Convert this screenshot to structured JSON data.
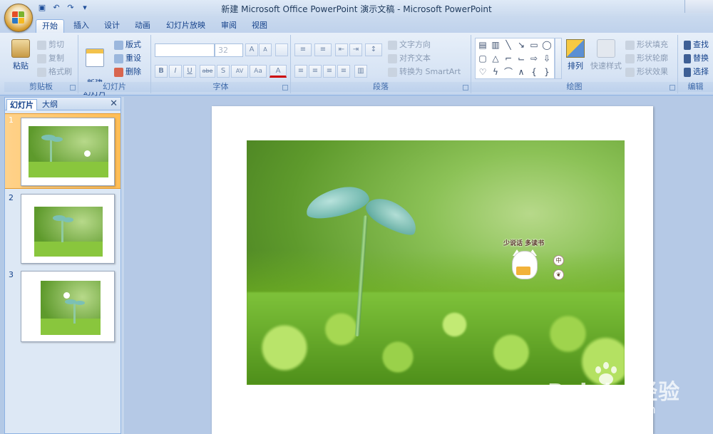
{
  "window": {
    "title": "新建 Microsoft Office PowerPoint 演示文稿 - Microsoft PowerPoint"
  },
  "qat": [
    "save-icon",
    "undo-icon",
    "redo-icon",
    "customize-icon"
  ],
  "tabs": [
    {
      "label": "开始",
      "active": true
    },
    {
      "label": "插入"
    },
    {
      "label": "设计"
    },
    {
      "label": "动画"
    },
    {
      "label": "幻灯片放映"
    },
    {
      "label": "审阅"
    },
    {
      "label": "视图"
    }
  ],
  "clipboard": {
    "group": "剪贴板",
    "paste": "粘贴",
    "cut": "剪切",
    "copy": "复制",
    "format_painter": "格式刷"
  },
  "slides_group": {
    "group": "幻灯片",
    "new_slide": "新建\n幻灯片",
    "layout": "版式",
    "reset": "重设",
    "delete": "删除"
  },
  "font": {
    "group": "字体",
    "name": "",
    "size": "32",
    "bold": "B",
    "italic": "I",
    "underline": "U",
    "strike": "abe",
    "shadow": "S",
    "spacing": "AV",
    "case": "Aa",
    "color": "A",
    "grow": "A",
    "shrink": "A"
  },
  "paragraph": {
    "group": "段落",
    "text_direction": "文字方向",
    "align_text": "对齐文本",
    "smartart": "转换为 SmartArt"
  },
  "drawing": {
    "group": "绘图",
    "arrange": "排列",
    "quick_styles": "快速样式",
    "shape_fill": "形状填充",
    "shape_outline": "形状轮廓",
    "shape_effects": "形状效果"
  },
  "editing": {
    "group": "编辑",
    "find": "查找",
    "replace": "替换",
    "select": "选择"
  },
  "panel": {
    "tab_slides": "幻灯片",
    "tab_outline": "大纲",
    "close": "✕",
    "slides": [
      {
        "num": "1",
        "selected": true
      },
      {
        "num": "2"
      },
      {
        "num": "3"
      }
    ]
  },
  "slide": {
    "cat_caption": "少说话 多读书",
    "badge_1": "中",
    "badge_2": "❦"
  },
  "watermark": {
    "main": "Bai du 经验",
    "sub": "jingyan.baidu.com"
  },
  "colors": {
    "ribbon": "#dbe6f4",
    "selection": "#ffbd55",
    "canvas": "#b5c9e6"
  }
}
